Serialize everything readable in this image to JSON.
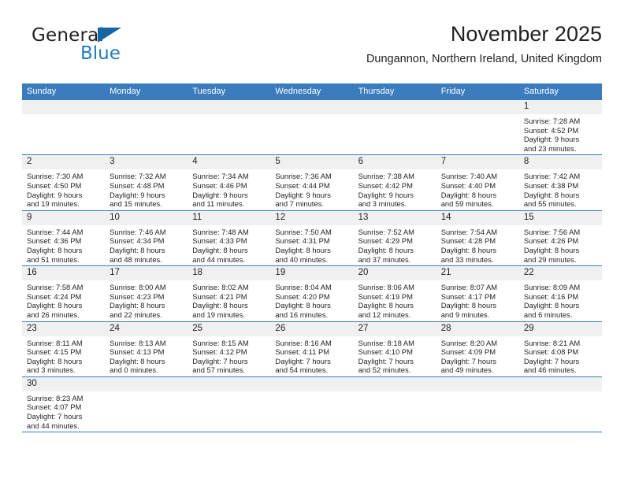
{
  "brand": {
    "name_part1": "General",
    "name_part2": "Blue",
    "logo_icon": "blue-flag-triangle",
    "accent_color": "#1f7fc4",
    "header_color": "#3a7cbe"
  },
  "header": {
    "title": "November 2025",
    "subtitle": "Dungannon, Northern Ireland, United Kingdom"
  },
  "calendar": {
    "weekday_headers": [
      "Sunday",
      "Monday",
      "Tuesday",
      "Wednesday",
      "Thursday",
      "Friday",
      "Saturday"
    ],
    "labels": {
      "sunrise": "Sunrise:",
      "sunset": "Sunset:",
      "daylight": "Daylight:"
    },
    "weeks": [
      [
        {
          "day": "",
          "empty": true,
          "sunrise": "",
          "sunset": "",
          "daylight_line1": "",
          "daylight_line2": ""
        },
        {
          "day": "",
          "empty": true,
          "sunrise": "",
          "sunset": "",
          "daylight_line1": "",
          "daylight_line2": ""
        },
        {
          "day": "",
          "empty": true,
          "sunrise": "",
          "sunset": "",
          "daylight_line1": "",
          "daylight_line2": ""
        },
        {
          "day": "",
          "empty": true,
          "sunrise": "",
          "sunset": "",
          "daylight_line1": "",
          "daylight_line2": ""
        },
        {
          "day": "",
          "empty": true,
          "sunrise": "",
          "sunset": "",
          "daylight_line1": "",
          "daylight_line2": ""
        },
        {
          "day": "",
          "empty": true,
          "sunrise": "",
          "sunset": "",
          "daylight_line1": "",
          "daylight_line2": ""
        },
        {
          "day": "1",
          "empty": false,
          "sunrise": "Sunrise: 7:28 AM",
          "sunset": "Sunset: 4:52 PM",
          "daylight_line1": "Daylight: 9 hours",
          "daylight_line2": "and 23 minutes."
        }
      ],
      [
        {
          "day": "2",
          "empty": false,
          "sunrise": "Sunrise: 7:30 AM",
          "sunset": "Sunset: 4:50 PM",
          "daylight_line1": "Daylight: 9 hours",
          "daylight_line2": "and 19 minutes."
        },
        {
          "day": "3",
          "empty": false,
          "sunrise": "Sunrise: 7:32 AM",
          "sunset": "Sunset: 4:48 PM",
          "daylight_line1": "Daylight: 9 hours",
          "daylight_line2": "and 15 minutes."
        },
        {
          "day": "4",
          "empty": false,
          "sunrise": "Sunrise: 7:34 AM",
          "sunset": "Sunset: 4:46 PM",
          "daylight_line1": "Daylight: 9 hours",
          "daylight_line2": "and 11 minutes."
        },
        {
          "day": "5",
          "empty": false,
          "sunrise": "Sunrise: 7:36 AM",
          "sunset": "Sunset: 4:44 PM",
          "daylight_line1": "Daylight: 9 hours",
          "daylight_line2": "and 7 minutes."
        },
        {
          "day": "6",
          "empty": false,
          "sunrise": "Sunrise: 7:38 AM",
          "sunset": "Sunset: 4:42 PM",
          "daylight_line1": "Daylight: 9 hours",
          "daylight_line2": "and 3 minutes."
        },
        {
          "day": "7",
          "empty": false,
          "sunrise": "Sunrise: 7:40 AM",
          "sunset": "Sunset: 4:40 PM",
          "daylight_line1": "Daylight: 8 hours",
          "daylight_line2": "and 59 minutes."
        },
        {
          "day": "8",
          "empty": false,
          "sunrise": "Sunrise: 7:42 AM",
          "sunset": "Sunset: 4:38 PM",
          "daylight_line1": "Daylight: 8 hours",
          "daylight_line2": "and 55 minutes."
        }
      ],
      [
        {
          "day": "9",
          "empty": false,
          "sunrise": "Sunrise: 7:44 AM",
          "sunset": "Sunset: 4:36 PM",
          "daylight_line1": "Daylight: 8 hours",
          "daylight_line2": "and 51 minutes."
        },
        {
          "day": "10",
          "empty": false,
          "sunrise": "Sunrise: 7:46 AM",
          "sunset": "Sunset: 4:34 PM",
          "daylight_line1": "Daylight: 8 hours",
          "daylight_line2": "and 48 minutes."
        },
        {
          "day": "11",
          "empty": false,
          "sunrise": "Sunrise: 7:48 AM",
          "sunset": "Sunset: 4:33 PM",
          "daylight_line1": "Daylight: 8 hours",
          "daylight_line2": "and 44 minutes."
        },
        {
          "day": "12",
          "empty": false,
          "sunrise": "Sunrise: 7:50 AM",
          "sunset": "Sunset: 4:31 PM",
          "daylight_line1": "Daylight: 8 hours",
          "daylight_line2": "and 40 minutes."
        },
        {
          "day": "13",
          "empty": false,
          "sunrise": "Sunrise: 7:52 AM",
          "sunset": "Sunset: 4:29 PM",
          "daylight_line1": "Daylight: 8 hours",
          "daylight_line2": "and 37 minutes."
        },
        {
          "day": "14",
          "empty": false,
          "sunrise": "Sunrise: 7:54 AM",
          "sunset": "Sunset: 4:28 PM",
          "daylight_line1": "Daylight: 8 hours",
          "daylight_line2": "and 33 minutes."
        },
        {
          "day": "15",
          "empty": false,
          "sunrise": "Sunrise: 7:56 AM",
          "sunset": "Sunset: 4:26 PM",
          "daylight_line1": "Daylight: 8 hours",
          "daylight_line2": "and 29 minutes."
        }
      ],
      [
        {
          "day": "16",
          "empty": false,
          "sunrise": "Sunrise: 7:58 AM",
          "sunset": "Sunset: 4:24 PM",
          "daylight_line1": "Daylight: 8 hours",
          "daylight_line2": "and 26 minutes."
        },
        {
          "day": "17",
          "empty": false,
          "sunrise": "Sunrise: 8:00 AM",
          "sunset": "Sunset: 4:23 PM",
          "daylight_line1": "Daylight: 8 hours",
          "daylight_line2": "and 22 minutes."
        },
        {
          "day": "18",
          "empty": false,
          "sunrise": "Sunrise: 8:02 AM",
          "sunset": "Sunset: 4:21 PM",
          "daylight_line1": "Daylight: 8 hours",
          "daylight_line2": "and 19 minutes."
        },
        {
          "day": "19",
          "empty": false,
          "sunrise": "Sunrise: 8:04 AM",
          "sunset": "Sunset: 4:20 PM",
          "daylight_line1": "Daylight: 8 hours",
          "daylight_line2": "and 16 minutes."
        },
        {
          "day": "20",
          "empty": false,
          "sunrise": "Sunrise: 8:06 AM",
          "sunset": "Sunset: 4:19 PM",
          "daylight_line1": "Daylight: 8 hours",
          "daylight_line2": "and 12 minutes."
        },
        {
          "day": "21",
          "empty": false,
          "sunrise": "Sunrise: 8:07 AM",
          "sunset": "Sunset: 4:17 PM",
          "daylight_line1": "Daylight: 8 hours",
          "daylight_line2": "and 9 minutes."
        },
        {
          "day": "22",
          "empty": false,
          "sunrise": "Sunrise: 8:09 AM",
          "sunset": "Sunset: 4:16 PM",
          "daylight_line1": "Daylight: 8 hours",
          "daylight_line2": "and 6 minutes."
        }
      ],
      [
        {
          "day": "23",
          "empty": false,
          "sunrise": "Sunrise: 8:11 AM",
          "sunset": "Sunset: 4:15 PM",
          "daylight_line1": "Daylight: 8 hours",
          "daylight_line2": "and 3 minutes."
        },
        {
          "day": "24",
          "empty": false,
          "sunrise": "Sunrise: 8:13 AM",
          "sunset": "Sunset: 4:13 PM",
          "daylight_line1": "Daylight: 8 hours",
          "daylight_line2": "and 0 minutes."
        },
        {
          "day": "25",
          "empty": false,
          "sunrise": "Sunrise: 8:15 AM",
          "sunset": "Sunset: 4:12 PM",
          "daylight_line1": "Daylight: 7 hours",
          "daylight_line2": "and 57 minutes."
        },
        {
          "day": "26",
          "empty": false,
          "sunrise": "Sunrise: 8:16 AM",
          "sunset": "Sunset: 4:11 PM",
          "daylight_line1": "Daylight: 7 hours",
          "daylight_line2": "and 54 minutes."
        },
        {
          "day": "27",
          "empty": false,
          "sunrise": "Sunrise: 8:18 AM",
          "sunset": "Sunset: 4:10 PM",
          "daylight_line1": "Daylight: 7 hours",
          "daylight_line2": "and 52 minutes."
        },
        {
          "day": "28",
          "empty": false,
          "sunrise": "Sunrise: 8:20 AM",
          "sunset": "Sunset: 4:09 PM",
          "daylight_line1": "Daylight: 7 hours",
          "daylight_line2": "and 49 minutes."
        },
        {
          "day": "29",
          "empty": false,
          "sunrise": "Sunrise: 8:21 AM",
          "sunset": "Sunset: 4:08 PM",
          "daylight_line1": "Daylight: 7 hours",
          "daylight_line2": "and 46 minutes."
        }
      ],
      [
        {
          "day": "30",
          "empty": false,
          "sunrise": "Sunrise: 8:23 AM",
          "sunset": "Sunset: 4:07 PM",
          "daylight_line1": "Daylight: 7 hours",
          "daylight_line2": "and 44 minutes."
        },
        {
          "day": "",
          "empty": true,
          "sunrise": "",
          "sunset": "",
          "daylight_line1": "",
          "daylight_line2": ""
        },
        {
          "day": "",
          "empty": true,
          "sunrise": "",
          "sunset": "",
          "daylight_line1": "",
          "daylight_line2": ""
        },
        {
          "day": "",
          "empty": true,
          "sunrise": "",
          "sunset": "",
          "daylight_line1": "",
          "daylight_line2": ""
        },
        {
          "day": "",
          "empty": true,
          "sunrise": "",
          "sunset": "",
          "daylight_line1": "",
          "daylight_line2": ""
        },
        {
          "day": "",
          "empty": true,
          "sunrise": "",
          "sunset": "",
          "daylight_line1": "",
          "daylight_line2": ""
        },
        {
          "day": "",
          "empty": true,
          "sunrise": "",
          "sunset": "",
          "daylight_line1": "",
          "daylight_line2": ""
        }
      ]
    ]
  }
}
